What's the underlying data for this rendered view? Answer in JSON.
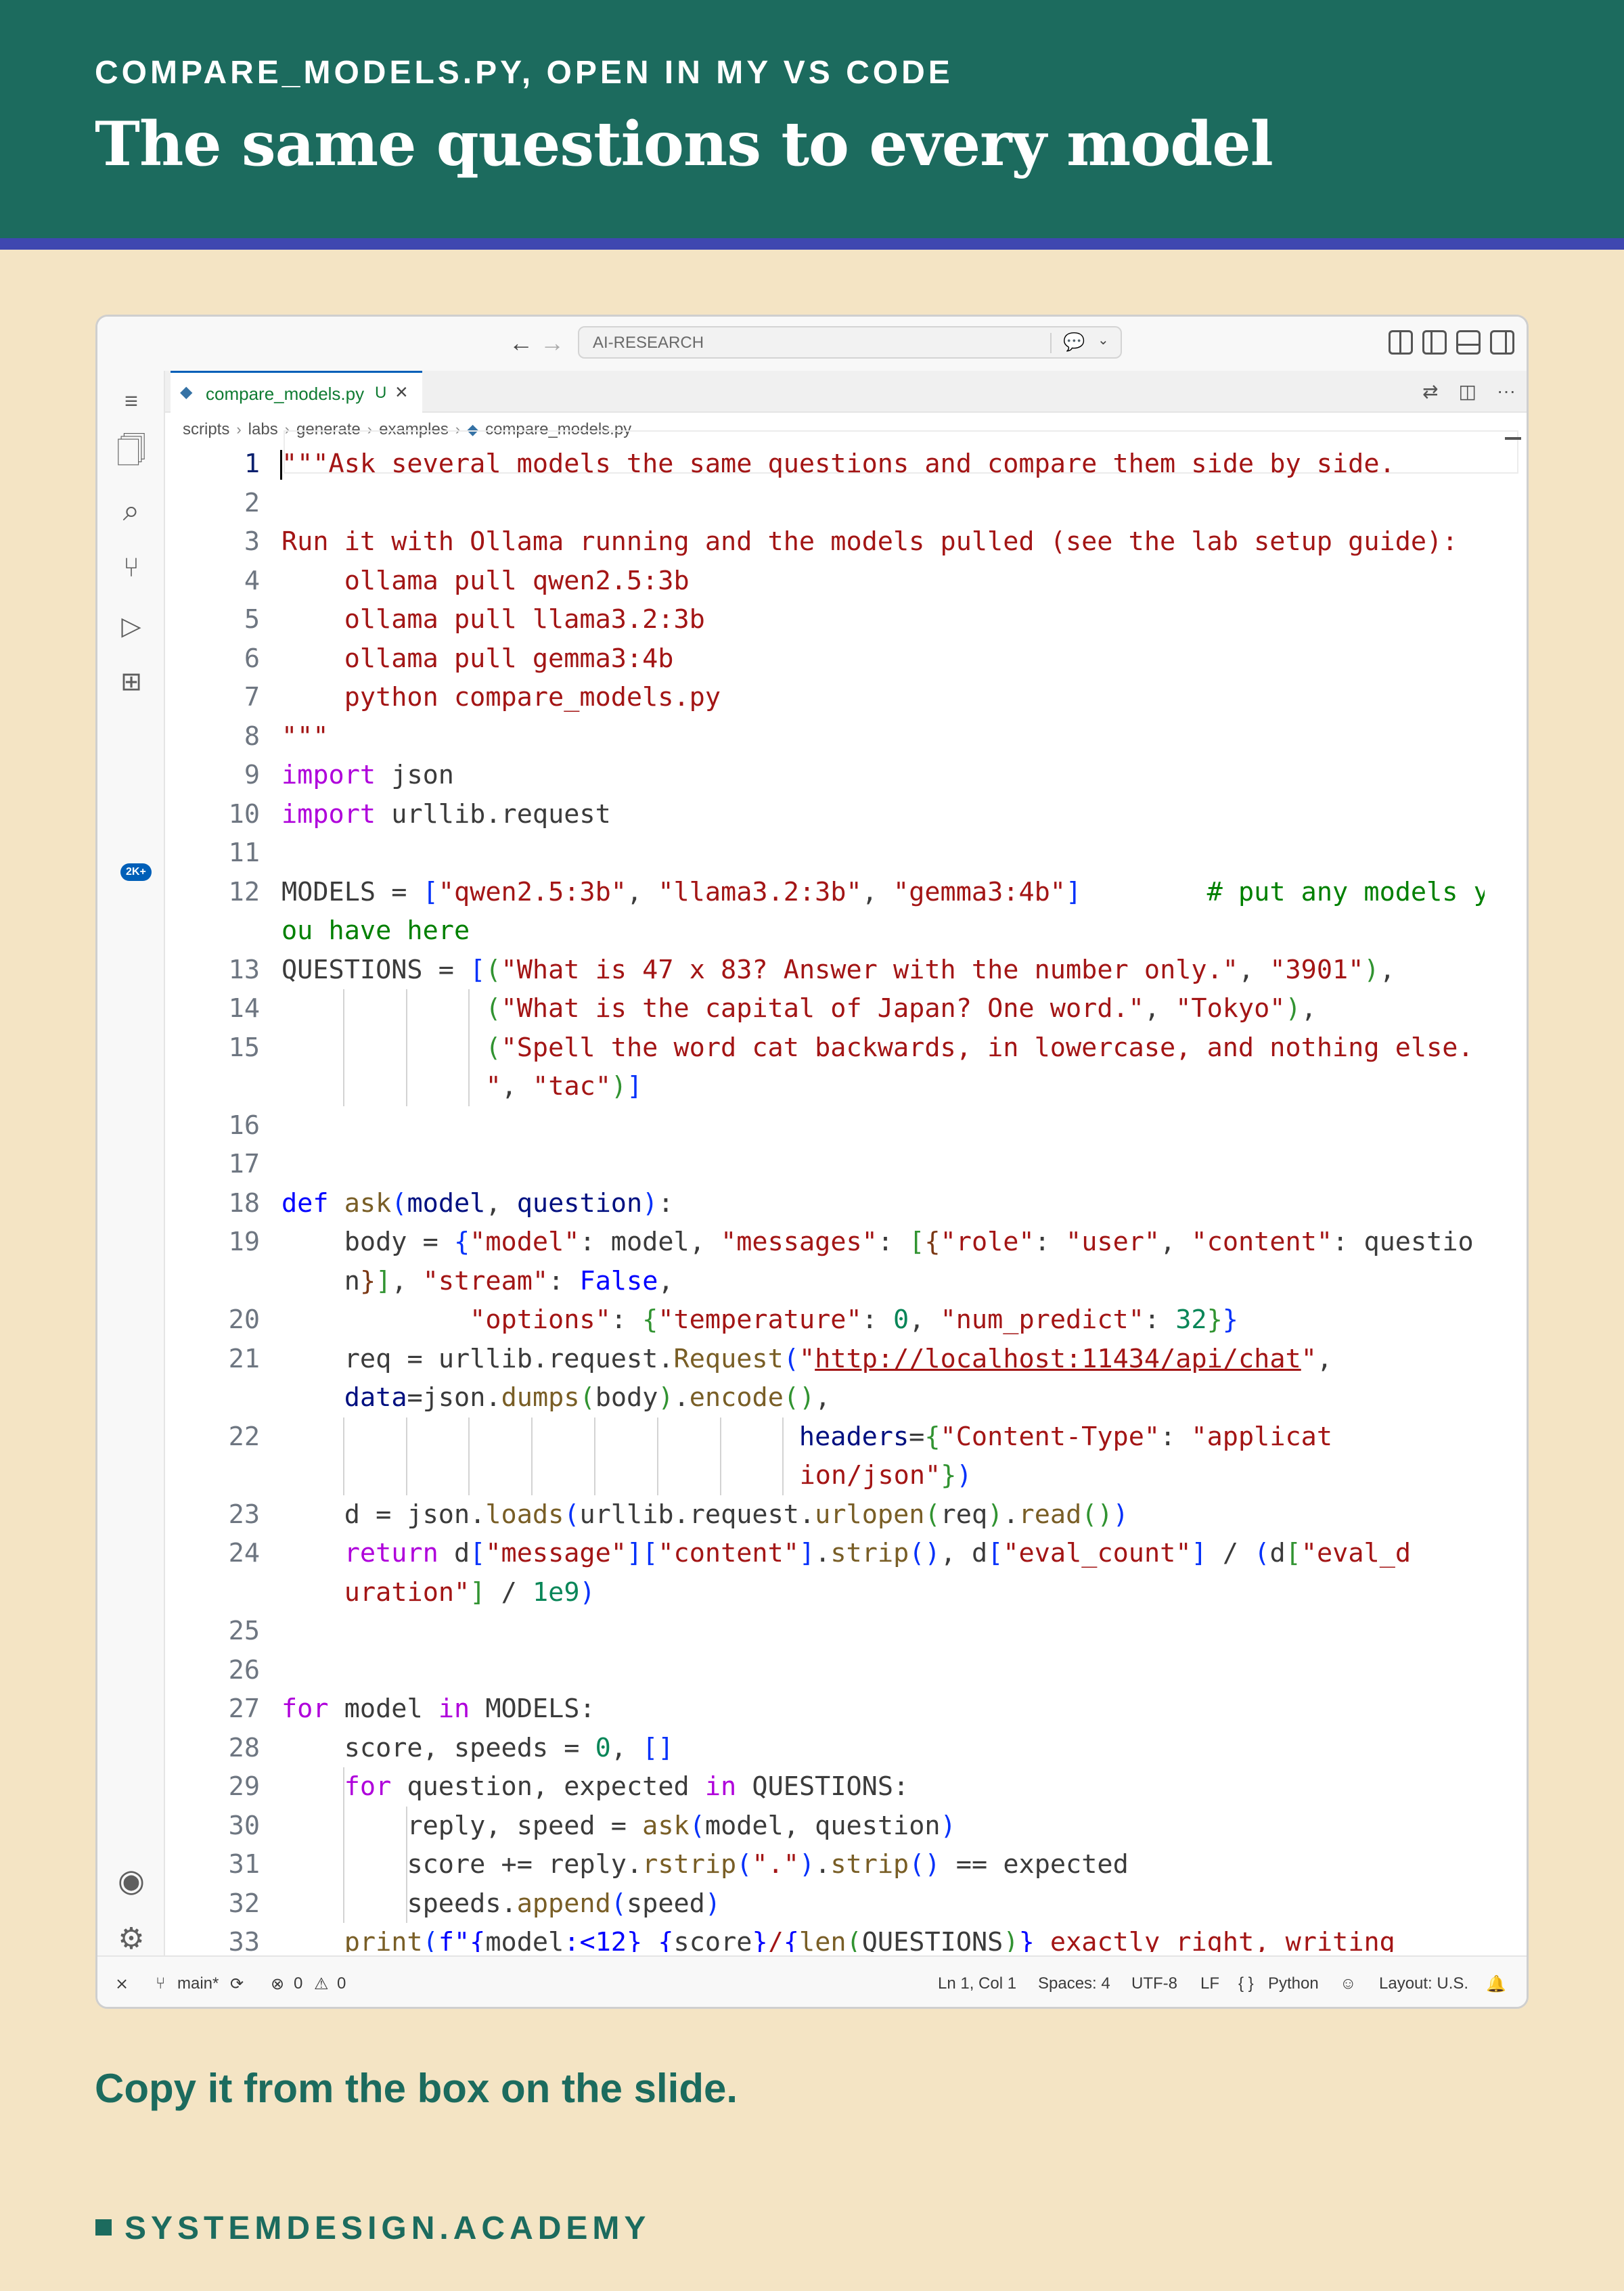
{
  "slide": {
    "eyebrow": "COMPARE_MODELS.PY, OPEN IN MY VS CODE",
    "headline": "The same questions to every model",
    "caption": "Copy it from the box on the slide.",
    "brand": "SYSTEMDESIGN.ACADEMY"
  },
  "colors": {
    "header_bg": "#1c6b5e",
    "header_rule": "#3f47b0",
    "page_bg": "#f4e4c4",
    "accent_text": "#1c6b5e"
  },
  "titlebar": {
    "search_text": "AI-RESEARCH",
    "icons": [
      "arrow-left-icon",
      "arrow-right-icon",
      "copilot-chat-icon",
      "chevron-down-icon",
      "customize-layout-icon",
      "toggle-primary-sidebar-icon",
      "toggle-panel-icon",
      "toggle-secondary-sidebar-icon"
    ]
  },
  "activitybar": {
    "items": [
      "menu-icon",
      "explorer-icon",
      "search-icon",
      "source-control-icon",
      "run-debug-icon",
      "extensions-icon"
    ],
    "source_control_badge": "2K+",
    "bottom": [
      "accounts-icon",
      "settings-gear-icon"
    ]
  },
  "tab": {
    "label": "compare_models.py",
    "status": "U"
  },
  "breadcrumb": [
    "scripts",
    "labs",
    "generate",
    "examples",
    "compare_models.py"
  ],
  "editor": {
    "cursor_line": 1,
    "lines": [
      "\"\"\"Ask several models the same questions and compare them side by side.",
      "",
      "Run it with Ollama running and the models pulled (see the lab setup guide):",
      "    ollama pull qwen2.5:3b",
      "    ollama pull llama3.2:3b",
      "    ollama pull gemma3:4b",
      "    python compare_models.py",
      "\"\"\"",
      "import json",
      "import urllib.request",
      "",
      "MODELS = [\"qwen2.5:3b\", \"llama3.2:3b\", \"gemma3:4b\"]        # put any models you have here",
      "QUESTIONS = [(\"What is 47 x 83? Answer with the number only.\", \"3901\"),",
      "             (\"What is the capital of Japan? One word.\", \"Tokyo\"),",
      "             (\"Spell the word cat backwards, in lowercase, and nothing else.\", \"tac\")]",
      "",
      "",
      "def ask(model, question):",
      "    body = {\"model\": model, \"messages\": [{\"role\": \"user\", \"content\": question}], \"stream\": False,",
      "            \"options\": {\"temperature\": 0, \"num_predict\": 32}}",
      "    req = urllib.request.Request(\"http://localhost:11434/api/chat\", data=json.dumps(body).encode(),",
      "                                 headers={\"Content-Type\": \"application/json\"})",
      "    d = json.loads(urllib.request.urlopen(req).read())",
      "    return d[\"message\"][\"content\"].strip(), d[\"eval_count\"] / (d[\"eval_duration\"] / 1e9)",
      "",
      "",
      "for model in MODELS:",
      "    score, speeds = 0, []",
      "    for question, expected in QUESTIONS:",
      "        reply, speed = ask(model, question)",
      "        score += reply.rstrip(\".\").strip() == expected",
      "        speeds.append(speed)",
      "    print(f\"{model:<12} {score}/{len(QUESTIONS)} exactly right, writing"
    ]
  },
  "statusbar": {
    "branch": "main*",
    "errors": "0",
    "warnings": "0",
    "position": "Ln 1, Col 1",
    "spaces": "Spaces: 4",
    "encoding": "UTF-8",
    "eol": "LF",
    "language_braces": "{ }",
    "language": "Python",
    "layout": "Layout: U.S."
  }
}
